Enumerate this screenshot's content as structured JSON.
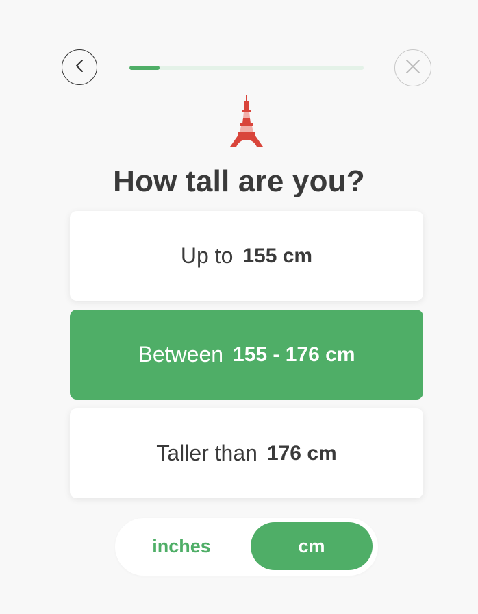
{
  "header": {
    "back_icon": "chevron-left-icon",
    "close_icon": "close-icon",
    "progress_fraction": 0.13
  },
  "illustration": {
    "icon": "eiffel-tower-icon",
    "color": "#d9453b"
  },
  "question": "How tall are you?",
  "options": [
    {
      "prefix": "Up to",
      "value": "155 cm",
      "selected": false
    },
    {
      "prefix": "Between",
      "value": "155 - 176 cm",
      "selected": true
    },
    {
      "prefix": "Taller than",
      "value": "176 cm",
      "selected": false
    }
  ],
  "units": {
    "inches_label": "inches",
    "cm_label": "cm",
    "selected": "cm"
  },
  "colors": {
    "accent": "#4fae67",
    "progress_track": "#e4f2e8",
    "text": "#3a3a3a",
    "background": "#f8f8f8"
  }
}
